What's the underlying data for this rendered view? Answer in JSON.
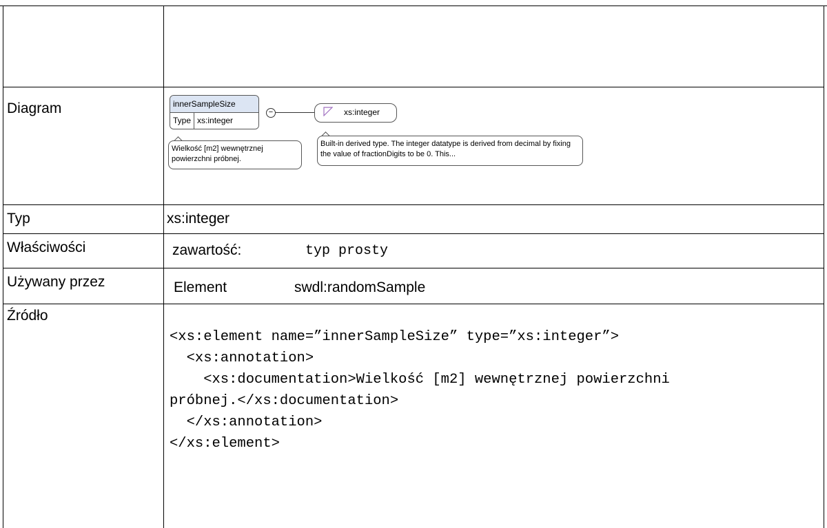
{
  "rows": {
    "diagram": {
      "label": "Diagram"
    },
    "typ": {
      "label": "Typ",
      "value": "xs:integer"
    },
    "wlasciwosci": {
      "label": "Właściwości",
      "key": "zawartość:",
      "value": "typ prosty"
    },
    "uzywany": {
      "label": "Używany przez",
      "kind": "Element",
      "ref": "swdl:randomSample"
    },
    "zrodlo": {
      "label": "Źródło"
    }
  },
  "diagram": {
    "element_name": "innerSampleSize",
    "type_key": "Type",
    "type_value": "xs:integer",
    "connector_symbol": "−",
    "element_annotation": "Wielkość [m2] wewnętrznej powierzchni próbnej.",
    "base_type_name": "xs:integer",
    "base_type_annotation": "Built-in derived type. The integer datatype is derived from decimal by fixing the value of fractionDigits to be 0. This..."
  },
  "source_code": [
    "<xs:element name=”innerSampleSize” type=”xs:integer”>",
    "  <xs:annotation>",
    "    <xs:documentation>Wielkość [m2] wewnętrznej powierzchni",
    "próbnej.</xs:documentation>",
    "  </xs:annotation>",
    "</xs:element>"
  ]
}
